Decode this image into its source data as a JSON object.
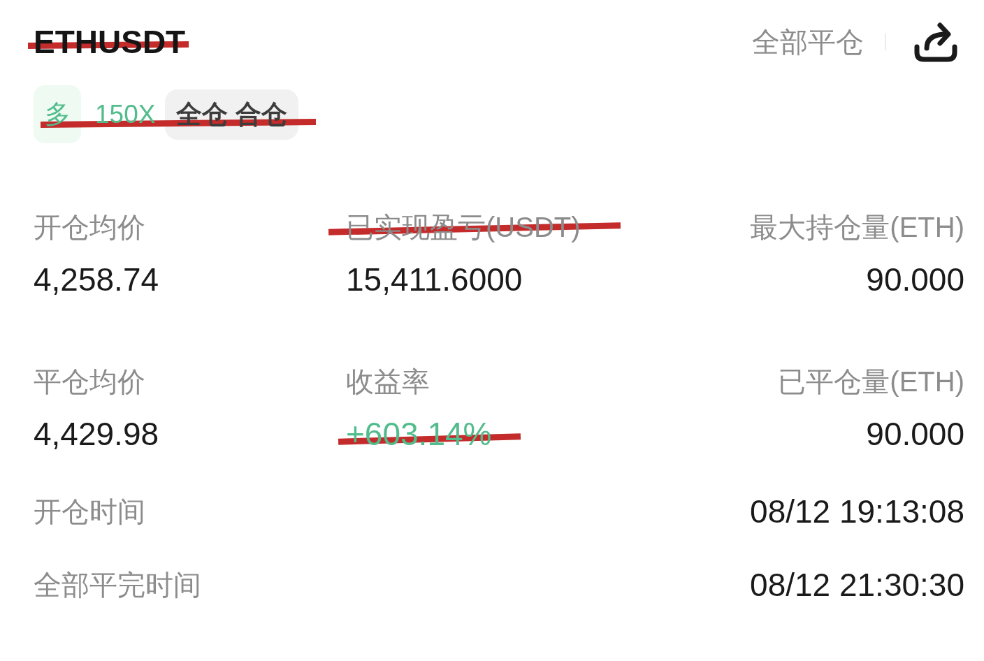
{
  "header": {
    "title": {
      "text": "ETHUSDT",
      "struck": true
    },
    "close_all_button": "全部平仓"
  },
  "tags": {
    "struck": true,
    "items": [
      {
        "kind": "side",
        "label": "多"
      },
      {
        "kind": "leverage",
        "label": "150X"
      },
      {
        "kind": "margin",
        "label": "全仓 合仓"
      }
    ]
  },
  "stats": [
    {
      "label": "开仓均价",
      "label_struck": false,
      "value": "4,258.74",
      "value_struck": false,
      "color": "#1a1a1a"
    },
    {
      "label": "已实现盈亏(USDT)",
      "label_struck": true,
      "value": "15,411.6000",
      "value_struck": false,
      "color": "#1a1a1a"
    },
    {
      "label": "最大持仓量(ETH)",
      "label_struck": false,
      "value": "90.000",
      "value_struck": false,
      "color": "#1a1a1a"
    },
    {
      "label": "平仓均价",
      "label_struck": false,
      "value": "4,429.98",
      "value_struck": false,
      "color": "#1a1a1a"
    },
    {
      "label": "收益率",
      "label_struck": false,
      "value": "+603.14%",
      "value_struck": true,
      "color": "#52bc8c"
    },
    {
      "label": "已平仓量(ETH)",
      "label_struck": false,
      "value": "90.000",
      "value_struck": false,
      "color": "#1a1a1a"
    }
  ],
  "times": [
    {
      "label": "开仓时间",
      "value": "08/12 19:13:08"
    },
    {
      "label": "全部平完时间",
      "value": "08/12 21:30:30"
    }
  ]
}
